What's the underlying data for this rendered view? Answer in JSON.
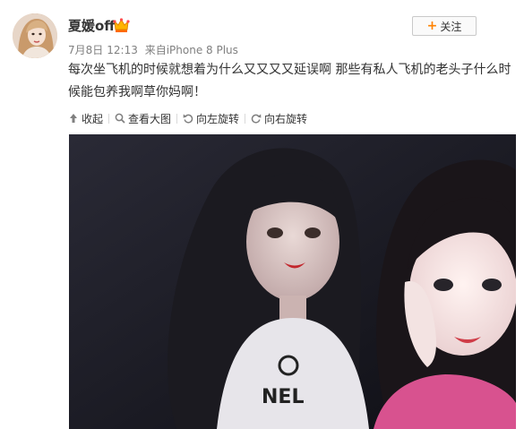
{
  "post": {
    "user": {
      "name": "夏媛off",
      "badge_icon": "vip-crown-icon"
    },
    "follow_button": {
      "icon": "plus-icon",
      "label": "关注"
    },
    "meta": {
      "date": "7月8日",
      "time": "12:13",
      "source_prefix": "来自",
      "source": "iPhone 8 Plus"
    },
    "text": "每次坐飞机的时候就想着为什么又又又又延误啊 那些有私人飞机的老头子什么时候能包养我啊草你妈啊！",
    "toolbar": {
      "collapse": {
        "icon": "collapse-up-icon",
        "label": "收起"
      },
      "view_large": {
        "icon": "magnify-icon",
        "label": "查看大图"
      },
      "rotate_left": {
        "icon": "rotate-left-icon",
        "label": "向左旋转"
      },
      "rotate_right": {
        "icon": "rotate-right-icon",
        "label": "向右旋转"
      }
    },
    "image": {
      "icon": "post-photo"
    }
  },
  "colors": {
    "text": "#333333",
    "meta": "#808080",
    "accent": "#ff8200",
    "border": "#c9c9c9",
    "photo_bg": "#15151d"
  }
}
